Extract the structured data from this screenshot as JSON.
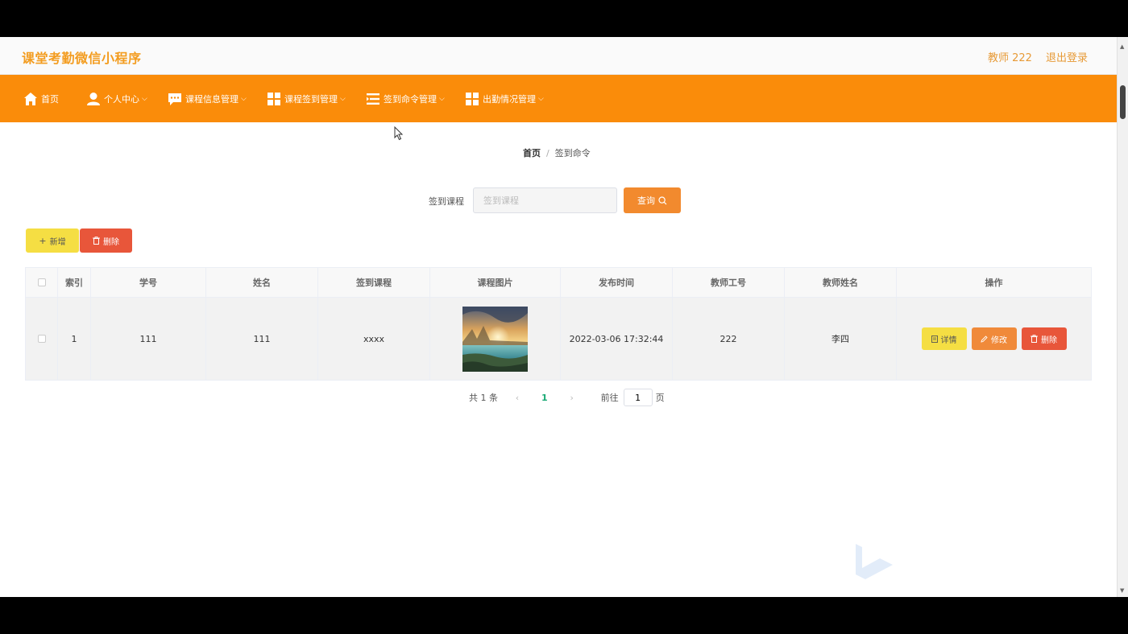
{
  "header": {
    "app_title": "课堂考勤微信小程序",
    "user_label": "教师 222",
    "logout_label": "退出登录"
  },
  "nav": {
    "items": [
      {
        "label": "首页",
        "icon": "home-icon",
        "has_dropdown": false
      },
      {
        "label": "个人中心",
        "icon": "user-icon",
        "has_dropdown": true
      },
      {
        "label": "课程信息管理",
        "icon": "message-icon",
        "has_dropdown": true
      },
      {
        "label": "课程签到管理",
        "icon": "grid-icon",
        "has_dropdown": true
      },
      {
        "label": "签到命令管理",
        "icon": "list-icon",
        "has_dropdown": true
      },
      {
        "label": "出勤情况管理",
        "icon": "grid-icon",
        "has_dropdown": true
      }
    ],
    "chevron": "⌵"
  },
  "breadcrumb": {
    "home": "首页",
    "separator": "/",
    "current": "签到命令"
  },
  "search": {
    "label": "签到课程",
    "placeholder": "签到课程",
    "value": "",
    "button_label": "查询"
  },
  "actions": {
    "add_label": "新增",
    "delete_label": "删除"
  },
  "table": {
    "headers": {
      "index": "索引",
      "student_id": "学号",
      "name": "姓名",
      "course": "签到课程",
      "image": "课程图片",
      "publish_time": "发布时间",
      "teacher_id": "教师工号",
      "teacher_name": "教师姓名",
      "operations": "操作"
    },
    "rows": [
      {
        "index": "1",
        "student_id": "111",
        "name": "111",
        "course": "xxxx",
        "publish_time": "2022-03-06 17:32:44",
        "teacher_id": "222",
        "teacher_name": "李四",
        "detail_label": "详情",
        "edit_label": "修改",
        "delete_label": "删除"
      }
    ]
  },
  "pagination": {
    "total_text": "共 1 条",
    "prev": "‹",
    "current_page": "1",
    "next": "›",
    "goto_label": "前往",
    "goto_value": "1",
    "page_unit": "页"
  },
  "colors": {
    "nav_bg": "#fa8c0a",
    "title": "#f39c1f",
    "yellow_btn": "#f5de43",
    "orange_btn": "#f08a3a",
    "red_btn": "#e8563a",
    "active_page": "#19a974"
  }
}
